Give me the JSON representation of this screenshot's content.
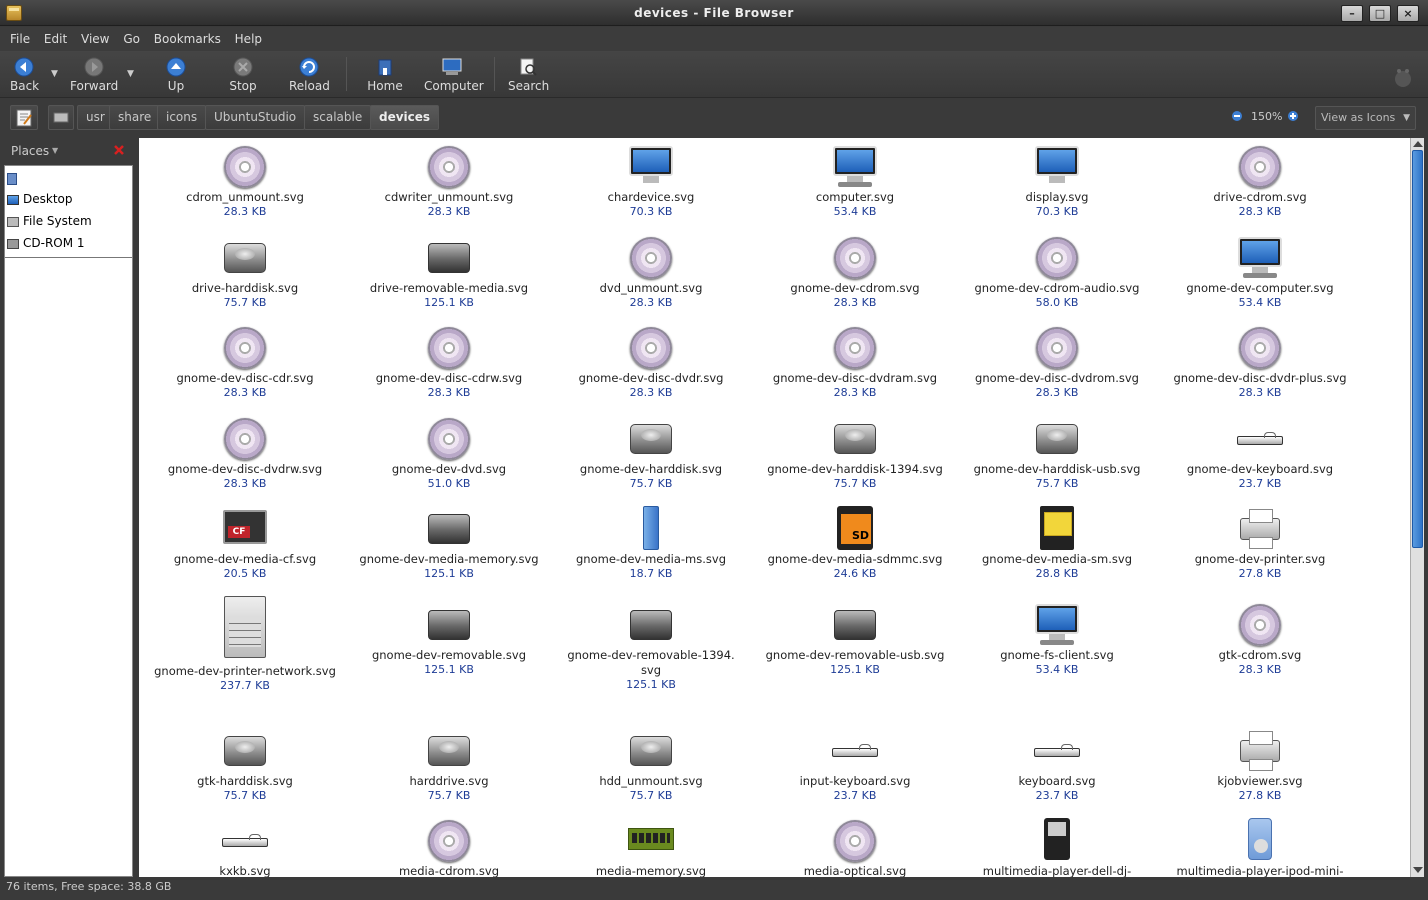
{
  "window": {
    "title": "devices - File Browser"
  },
  "menu": [
    "File",
    "Edit",
    "View",
    "Go",
    "Bookmarks",
    "Help"
  ],
  "toolbar": {
    "back": "Back",
    "forward": "Forward",
    "up": "Up",
    "stop": "Stop",
    "reload": "Reload",
    "home": "Home",
    "computer": "Computer",
    "search": "Search"
  },
  "path": [
    "usr",
    "share",
    "icons",
    "UbuntuStudio",
    "scalable",
    "devices"
  ],
  "zoom": "150%",
  "view_select": "View as Icons",
  "sidebar": {
    "title": "Places",
    "items": [
      "Desktop",
      "File System",
      "CD-ROM 1"
    ]
  },
  "files": [
    {
      "name": "cdrom_unmount.svg",
      "size": "28.3 KB",
      "icon": "cd"
    },
    {
      "name": "cdwriter_unmount.svg",
      "size": "28.3 KB",
      "icon": "cd"
    },
    {
      "name": "chardevice.svg",
      "size": "70.3 KB",
      "icon": "monitor"
    },
    {
      "name": "computer.svg",
      "size": "53.4 KB",
      "icon": "computer"
    },
    {
      "name": "display.svg",
      "size": "70.3 KB",
      "icon": "monitor"
    },
    {
      "name": "drive-cdrom.svg",
      "size": "28.3 KB",
      "icon": "cd"
    },
    {
      "name": "drive-harddisk.svg",
      "size": "75.7 KB",
      "icon": "hdd"
    },
    {
      "name": "drive-removable-media.svg",
      "size": "125.1 KB",
      "icon": "removable"
    },
    {
      "name": "dvd_unmount.svg",
      "size": "28.3 KB",
      "icon": "cd"
    },
    {
      "name": "gnome-dev-cdrom.svg",
      "size": "28.3 KB",
      "icon": "cd"
    },
    {
      "name": "gnome-dev-cdrom-audio.svg",
      "size": "58.0 KB",
      "icon": "cd"
    },
    {
      "name": "gnome-dev-computer.svg",
      "size": "53.4 KB",
      "icon": "computer"
    },
    {
      "name": "gnome-dev-disc-cdr.svg",
      "size": "28.3 KB",
      "icon": "cd"
    },
    {
      "name": "gnome-dev-disc-cdrw.svg",
      "size": "28.3 KB",
      "icon": "cd"
    },
    {
      "name": "gnome-dev-disc-dvdr.svg",
      "size": "28.3 KB",
      "icon": "cd"
    },
    {
      "name": "gnome-dev-disc-dvdram.svg",
      "size": "28.3 KB",
      "icon": "cd"
    },
    {
      "name": "gnome-dev-disc-dvdrom.svg",
      "size": "28.3 KB",
      "icon": "cd"
    },
    {
      "name": "gnome-dev-disc-dvdr-plus.svg",
      "size": "28.3 KB",
      "icon": "cd"
    },
    {
      "name": "gnome-dev-disc-dvdrw.svg",
      "size": "28.3 KB",
      "icon": "cd"
    },
    {
      "name": "gnome-dev-dvd.svg",
      "size": "51.0 KB",
      "icon": "cd"
    },
    {
      "name": "gnome-dev-harddisk.svg",
      "size": "75.7 KB",
      "icon": "hdd"
    },
    {
      "name": "gnome-dev-harddisk-1394.svg",
      "size": "75.7 KB",
      "icon": "hdd"
    },
    {
      "name": "gnome-dev-harddisk-usb.svg",
      "size": "75.7 KB",
      "icon": "hdd"
    },
    {
      "name": "gnome-dev-keyboard.svg",
      "size": "23.7 KB",
      "icon": "keyboard"
    },
    {
      "name": "gnome-dev-media-cf.svg",
      "size": "20.5 KB",
      "icon": "cf"
    },
    {
      "name": "gnome-dev-media-memory.svg",
      "size": "125.1 KB",
      "icon": "removable"
    },
    {
      "name": "gnome-dev-media-ms.svg",
      "size": "18.7 KB",
      "icon": "ms"
    },
    {
      "name": "gnome-dev-media-sdmmc.svg",
      "size": "24.6 KB",
      "icon": "sd"
    },
    {
      "name": "gnome-dev-media-sm.svg",
      "size": "28.8 KB",
      "icon": "sm"
    },
    {
      "name": "gnome-dev-printer.svg",
      "size": "27.8 KB",
      "icon": "printer"
    },
    {
      "name": "gnome-dev-printer-network.svg",
      "size": "237.7 KB",
      "icon": "printer-network"
    },
    {
      "name": "gnome-dev-removable.svg",
      "size": "125.1 KB",
      "icon": "removable"
    },
    {
      "name": "gnome-dev-removable-1394.svg",
      "size": "125.1 KB",
      "icon": "removable"
    },
    {
      "name": "gnome-dev-removable-usb.svg",
      "size": "125.1 KB",
      "icon": "removable"
    },
    {
      "name": "gnome-fs-client.svg",
      "size": "53.4 KB",
      "icon": "computer"
    },
    {
      "name": "gtk-cdrom.svg",
      "size": "28.3 KB",
      "icon": "cd"
    },
    {
      "name": "gtk-harddisk.svg",
      "size": "75.7 KB",
      "icon": "hdd"
    },
    {
      "name": "harddrive.svg",
      "size": "75.7 KB",
      "icon": "hdd"
    },
    {
      "name": "hdd_unmount.svg",
      "size": "75.7 KB",
      "icon": "hdd"
    },
    {
      "name": "input-keyboard.svg",
      "size": "23.7 KB",
      "icon": "keyboard"
    },
    {
      "name": "keyboard.svg",
      "size": "23.7 KB",
      "icon": "keyboard"
    },
    {
      "name": "kjobviewer.svg",
      "size": "27.8 KB",
      "icon": "printer"
    },
    {
      "name": "kxkb.svg",
      "size": "",
      "icon": "keyboard"
    },
    {
      "name": "media-cdrom.svg",
      "size": "",
      "icon": "cd"
    },
    {
      "name": "media-memory.svg",
      "size": "",
      "icon": "memory"
    },
    {
      "name": "media-optical.svg",
      "size": "",
      "icon": "cd"
    },
    {
      "name": "multimedia-player-dell-dj-",
      "size": "",
      "icon": "player"
    },
    {
      "name": "multimedia-player-ipod-mini-",
      "size": "",
      "icon": "ipod"
    }
  ],
  "status": "76 items, Free space: 38.8 GB"
}
